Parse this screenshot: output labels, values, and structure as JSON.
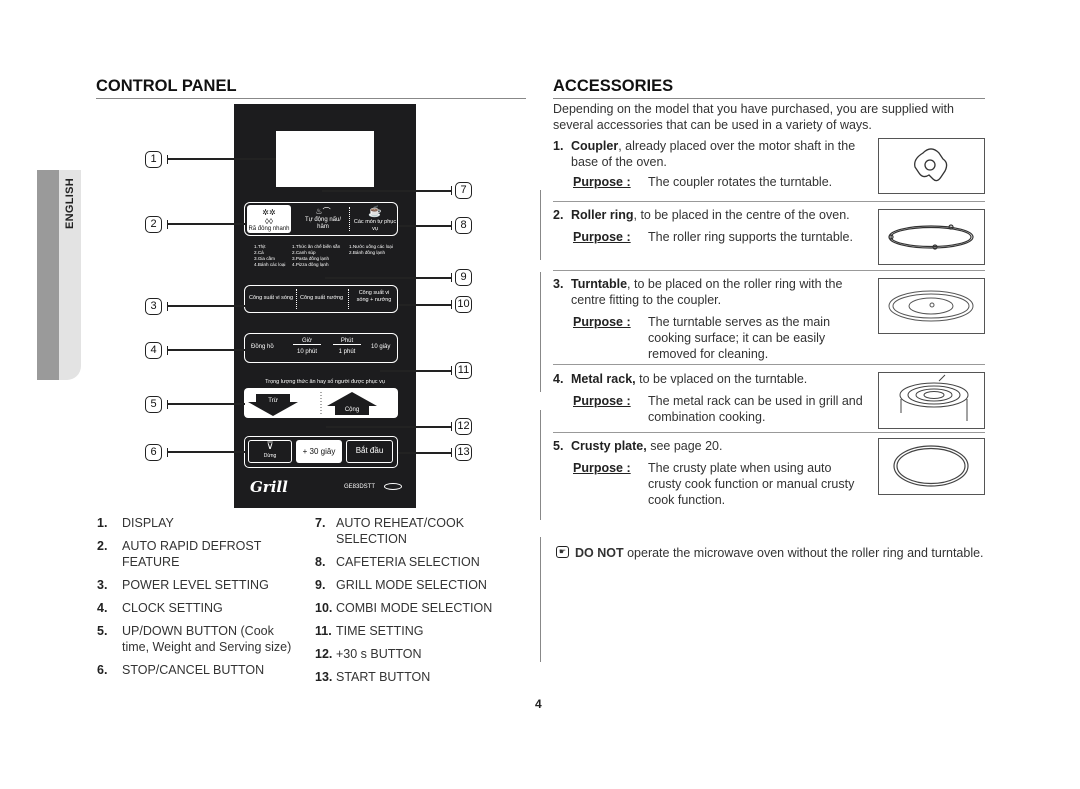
{
  "language_tab": "ENGLISH",
  "control_panel": {
    "title": "CONTROL PANEL",
    "panel_graphic": {
      "auto_defrost": {
        "icon": "snowflake-drops-icon",
        "label": "Rã đông nhanh"
      },
      "auto_cook": {
        "icon": "steam-pot-icon",
        "label": "Tự động nấu/ hâm"
      },
      "cafeteria": {
        "icon": "coffee-cup-icon",
        "label": "Các món tự phục vụ"
      },
      "defrost_list": [
        "1.Thịt",
        "2.Cá",
        "3.Gia cầm",
        "4.Bánh các loại"
      ],
      "cook_list": [
        "1.Thức ăn chế biến sẵn",
        "2.Canh súp",
        "3.Pasta đông lạnh",
        "4.Pizza đông lạnh"
      ],
      "cafe_list": [
        "1.Nước uống các loại",
        "2.Bánh đông lạnh"
      ],
      "power": [
        "Công suất vi sóng",
        "Công suất nướng",
        "Công suất vi sóng + nướng"
      ],
      "clock": {
        "clock": "Đồng hồ",
        "hour_top": "Giờ",
        "hour_bottom": "10 phút",
        "min_top": "Phút",
        "min_bottom": "1 phút",
        "sec": "10 giây"
      },
      "weight_label": "Trọng lượng thức ăn hay số người được phục vụ",
      "down": "Trừ",
      "up": "Cộng",
      "stop": {
        "icon": "stop-icon",
        "label": "Dừng"
      },
      "plus30": "+ 30 giây",
      "start": "Bắt đầu",
      "brand": "Grill",
      "model": "GE83DSTT"
    },
    "callouts": [
      "1",
      "2",
      "3",
      "4",
      "5",
      "6",
      "7",
      "8",
      "9",
      "10",
      "11",
      "12",
      "13"
    ],
    "legend_left": [
      {
        "num": "1.",
        "text": "DISPLAY"
      },
      {
        "num": "2.",
        "text": "AUTO RAPID DEFROST",
        "text2": "FEATURE"
      },
      {
        "num": "3.",
        "text": "POWER LEVEL SETTING"
      },
      {
        "num": "4.",
        "text": "CLOCK SETTING"
      },
      {
        "num": "5.",
        "text": "UP/DOWN BUTTON (Cook",
        "text2": "time, Weight and Serving size)"
      },
      {
        "num": "6.",
        "text": "STOP/CANCEL BUTTON"
      }
    ],
    "legend_right": [
      {
        "num": "7.",
        "text": "AUTO REHEAT/COOK",
        "text2": "SELECTION"
      },
      {
        "num": "8.",
        "text": "CAFETERIA SELECTION"
      },
      {
        "num": "9.",
        "text": "GRILL MODE SELECTION"
      },
      {
        "num": "10.",
        "text": "COMBI MODE SELECTION"
      },
      {
        "num": "11.",
        "text": "TIME SETTING"
      },
      {
        "num": "12.",
        "text": "+30 s BUTTON"
      },
      {
        "num": "13.",
        "text": "START BUTTON"
      }
    ]
  },
  "accessories": {
    "title": "ACCESSORIES",
    "intro": "Depending on the model that you have purchased, you are supplied with several accessories that can be used in a variety of ways.",
    "purpose_label": "Purpose :",
    "items": [
      {
        "num": "1.",
        "name": "Coupler",
        "desc": ", already placed over the motor shaft in the base of the oven.",
        "purpose": "The coupler rotates the turntable.",
        "image": "coupler-image"
      },
      {
        "num": "2.",
        "name": "Roller ring",
        "desc": ", to be placed in the centre of the oven.",
        "purpose": "The roller ring supports the turntable.",
        "image": "roller-ring-image"
      },
      {
        "num": "3.",
        "name": "Turntable",
        "desc": ", to be placed on the roller ring with the centre fitting to the coupler.",
        "purpose": "The turntable serves as the main cooking surface; it can be easily removed for cleaning.",
        "image": "turntable-image"
      },
      {
        "num": "4.",
        "name": "Metal rack,",
        "desc": " to be vplaced on the turntable.",
        "purpose": "The metal rack can be used in grill and combination cooking.",
        "image": "metal-rack-image"
      },
      {
        "num": "5.",
        "name": "Crusty plate,",
        "desc": " see page 20.",
        "purpose": "The crusty plate when using auto crusty cook function or manual crusty cook function.",
        "image": "crusty-plate-image"
      }
    ],
    "note": {
      "icon": "pointing-hand-icon",
      "bold": "DO NOT",
      "text": " operate the microwave oven without the roller ring and turntable."
    }
  },
  "page_number": "4"
}
